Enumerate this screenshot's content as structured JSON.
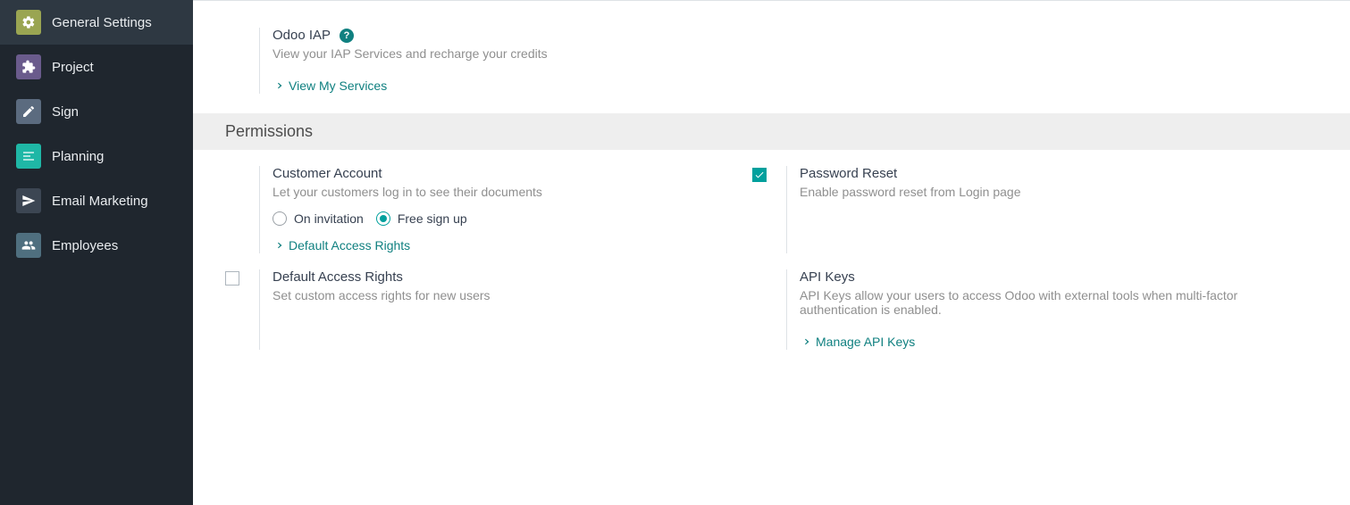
{
  "sidebar": {
    "items": [
      {
        "label": "General Settings",
        "icon": "gear",
        "color": "#9aa552",
        "active": true
      },
      {
        "label": "Project",
        "icon": "puzzle",
        "color": "#6a5b8c",
        "active": false
      },
      {
        "label": "Sign",
        "icon": "sign",
        "color": "#5b6b7f",
        "active": false
      },
      {
        "label": "Planning",
        "icon": "planning",
        "color": "#1fb7a6",
        "active": false
      },
      {
        "label": "Email Marketing",
        "icon": "send",
        "color": "#3c4653",
        "active": false
      },
      {
        "label": "Employees",
        "icon": "people",
        "color": "#4f6f7f",
        "active": false
      }
    ]
  },
  "iap": {
    "title": "Odoo IAP",
    "desc": "View your IAP Services and recharge your credits",
    "link": "View My Services"
  },
  "permissions_header": "Permissions",
  "customer_account": {
    "title": "Customer Account",
    "desc": "Let your customers log in to see their documents",
    "radio_invitation": "On invitation",
    "radio_free": "Free sign up",
    "link": "Default Access Rights"
  },
  "password_reset": {
    "title": "Password Reset",
    "desc": "Enable password reset from Login page",
    "checked": true
  },
  "default_access": {
    "title": "Default Access Rights",
    "desc": "Set custom access rights for new users",
    "checked": false
  },
  "api_keys": {
    "title": "API Keys",
    "desc": "API Keys allow your users to access Odoo with external tools when multi-factor authentication is enabled.",
    "link": "Manage API Keys"
  }
}
